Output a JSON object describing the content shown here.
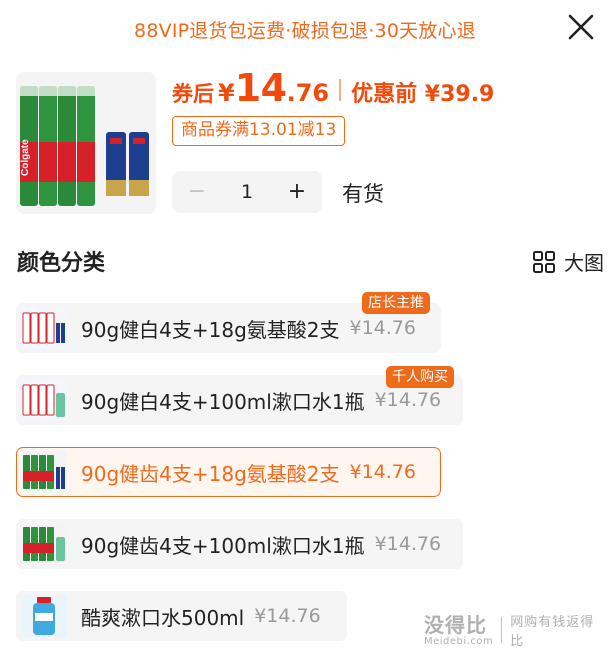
{
  "banner": {
    "text": "88VIP退货包运费·破损包退·30天放心退"
  },
  "product": {
    "price_after_label": "券后",
    "price_currency": "¥",
    "price_int": "14",
    "price_dec": ".76",
    "price_before_text": "优惠前 ¥39.9",
    "coupon_text": "商品券满13.01减13",
    "quantity": "1",
    "minus_label": "−",
    "plus_label": "+",
    "stock_text": "有货",
    "brand_text": "Colgate"
  },
  "section": {
    "title": "颜色分类",
    "view_toggle_label": "大图"
  },
  "options": [
    {
      "name": "90g健白4支+18g氨基酸2支",
      "price": "¥14.76",
      "badge": "店长主推",
      "selected": false
    },
    {
      "name": "90g健白4支+100ml漱口水1瓶",
      "price": "¥14.76",
      "badge": "千人购买",
      "selected": false
    },
    {
      "name": "90g健齿4支+18g氨基酸2支",
      "price": "¥14.76",
      "badge": "",
      "selected": true
    },
    {
      "name": "90g健齿4支+100ml漱口水1瓶",
      "price": "¥14.76",
      "badge": "",
      "selected": false
    },
    {
      "name": "酷爽漱口水500ml",
      "price": "¥14.76",
      "badge": "",
      "selected": false
    }
  ],
  "watermark": {
    "main": "没得比",
    "sub": "Meidebi.com",
    "slogan": "网购有钱返得比"
  },
  "colors": {
    "accent": "#f06a1c",
    "price": "#f04a0c",
    "muted": "#999999",
    "option_bg": "#f5f5f5"
  }
}
